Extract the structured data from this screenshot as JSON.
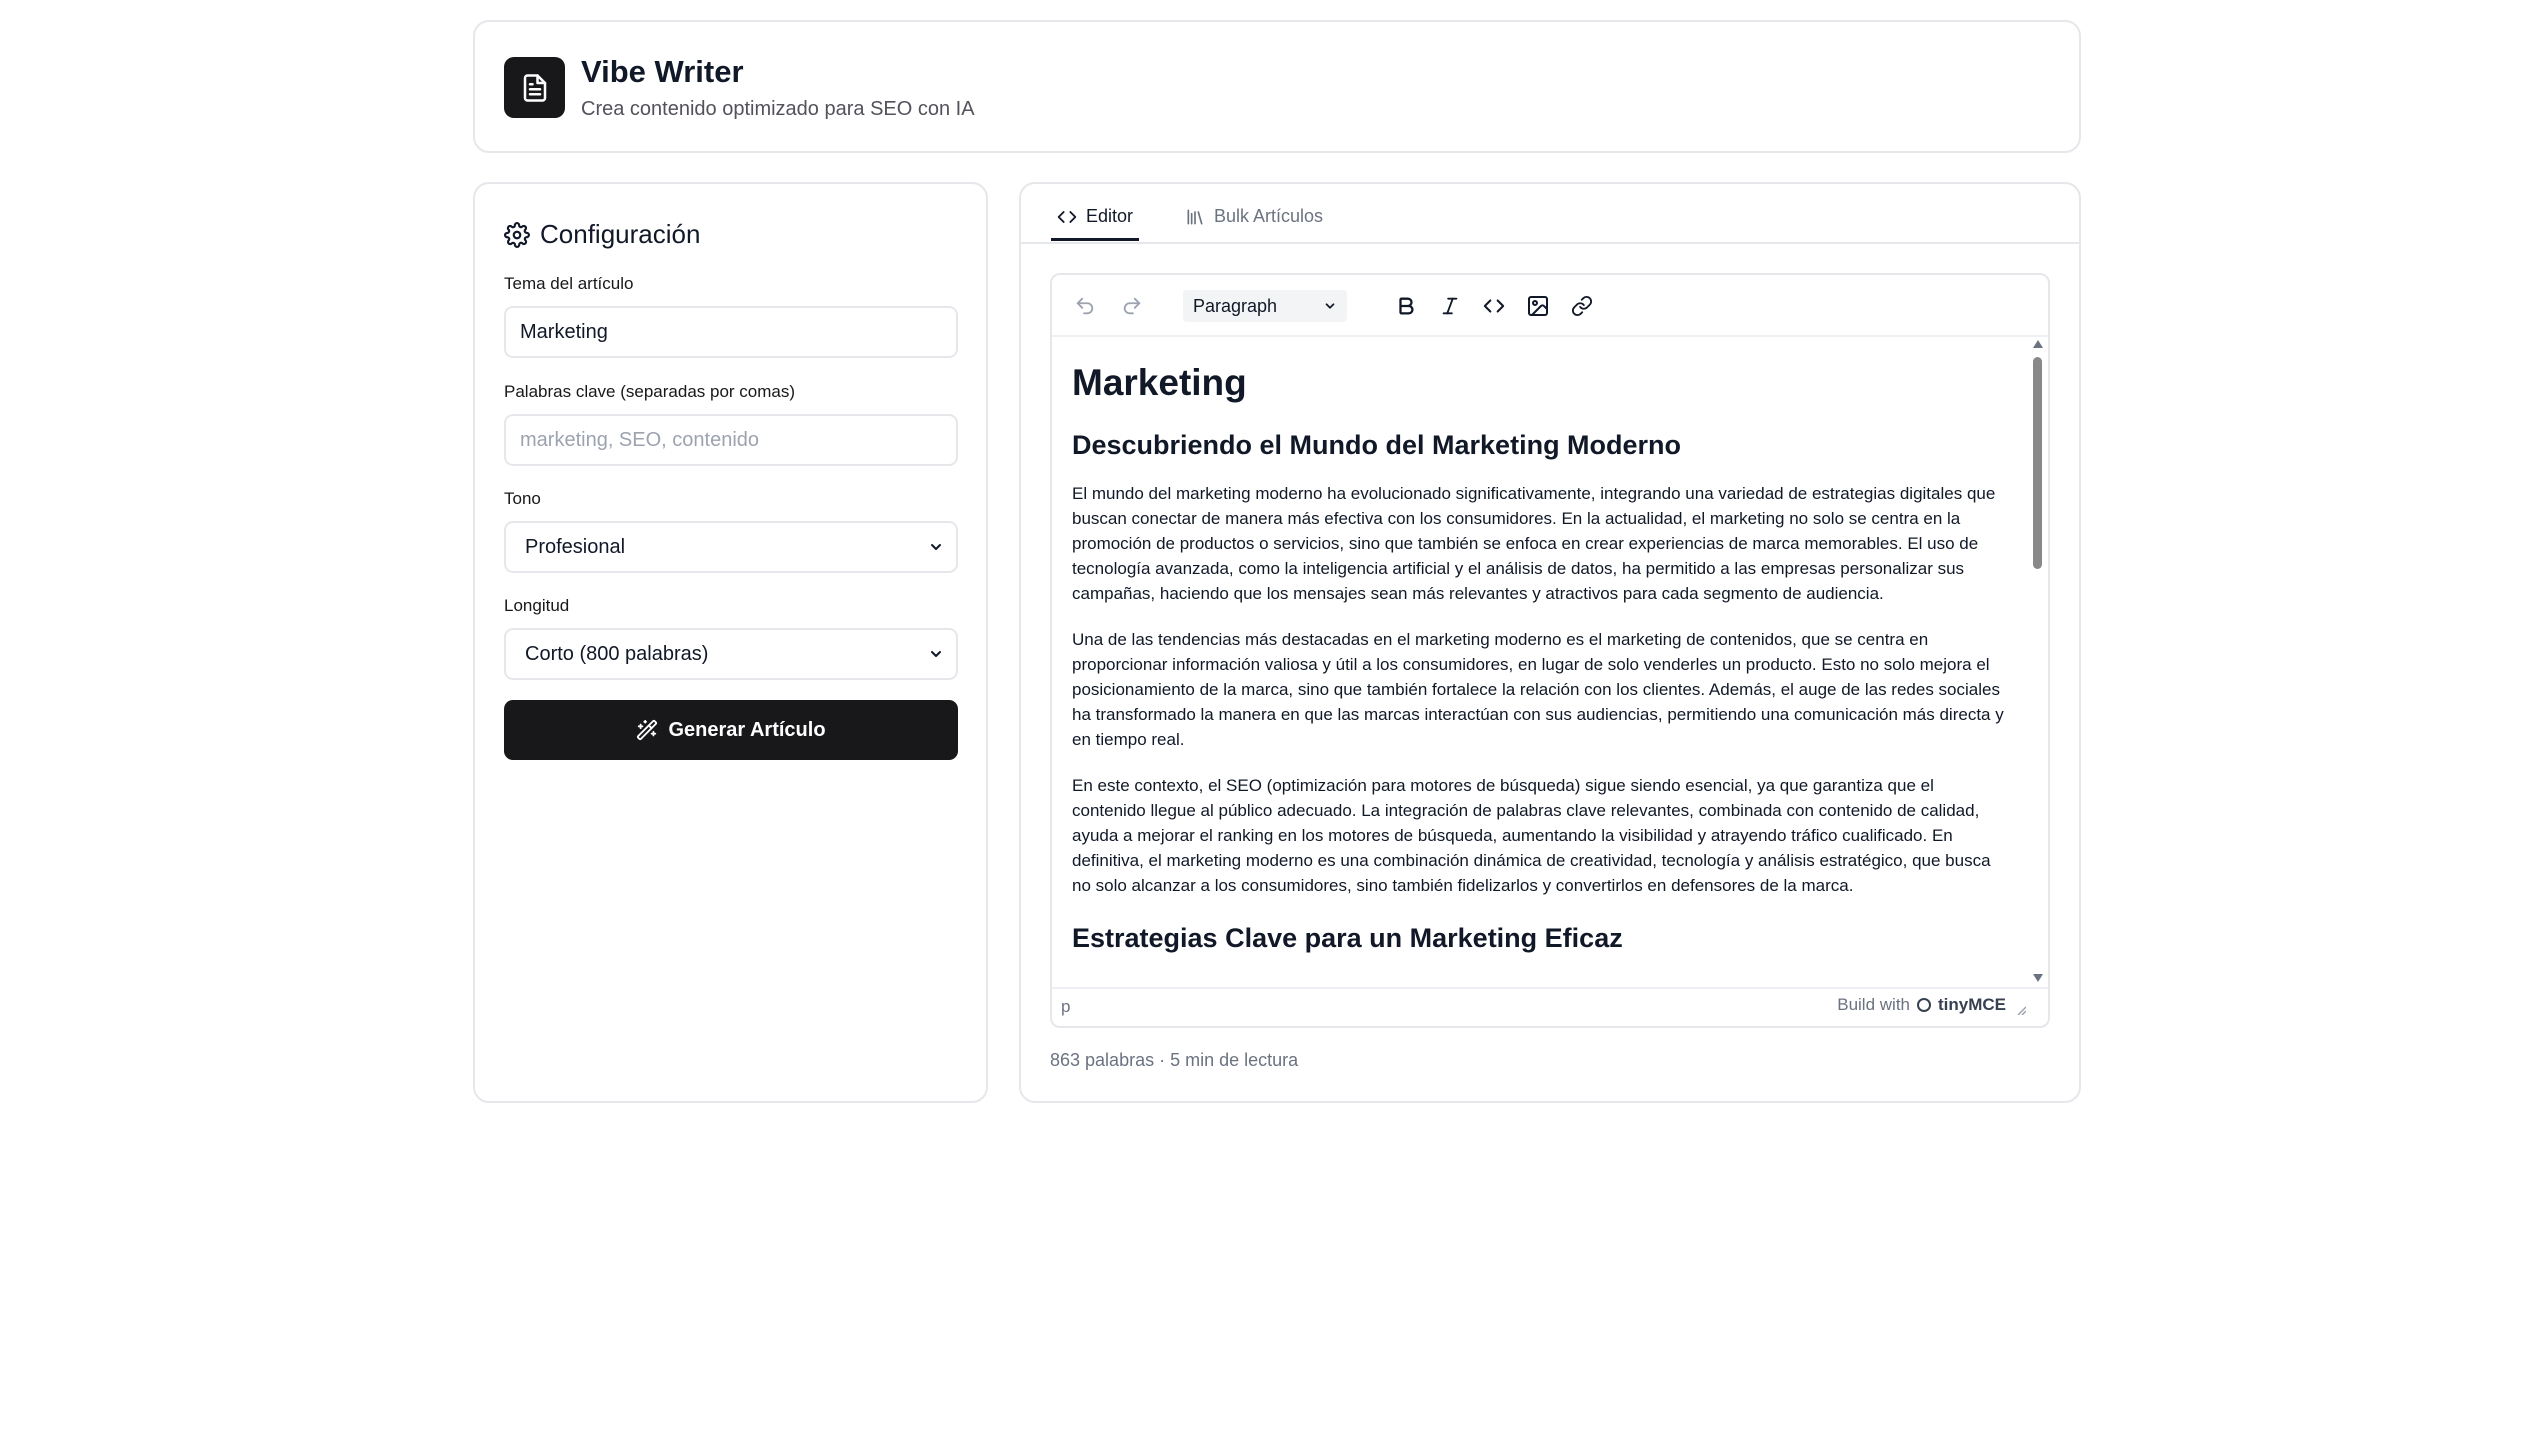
{
  "header": {
    "title": "Vibe Writer",
    "subtitle": "Crea contenido optimizado para SEO con IA",
    "logo_icon": "document-icon"
  },
  "config": {
    "title": "Configuración",
    "topic_label": "Tema del artículo",
    "topic_value": "Marketing",
    "keywords_label": "Palabras clave (separadas por comas)",
    "keywords_placeholder": "marketing, SEO, contenido",
    "tone_label": "Tono",
    "tone_value": "Profesional",
    "length_label": "Longitud",
    "length_value": "Corto (800 palabras)",
    "generate_label": "Generar Artículo"
  },
  "tabs": [
    {
      "label": "Editor",
      "active": true,
      "icon": "code-icon"
    },
    {
      "label": "Bulk Artículos",
      "active": false,
      "icon": "library-icon"
    }
  ],
  "editor": {
    "block_format": "Paragraph",
    "status_path": "p",
    "branding_prefix": "Build with",
    "branding_name": "tinyMCE",
    "content": {
      "h1": "Marketing",
      "h2_1": "Descubriendo el Mundo del Marketing Moderno",
      "p1": "El mundo del marketing moderno ha evolucionado significativamente, integrando una variedad de estrategias digitales que buscan conectar de manera más efectiva con los consumidores. En la actualidad, el marketing no solo se centra en la promoción de productos o servicios, sino que también se enfoca en crear experiencias de marca memorables. El uso de tecnología avanzada, como la inteligencia artificial y el análisis de datos, ha permitido a las empresas personalizar sus campañas, haciendo que los mensajes sean más relevantes y atractivos para cada segmento de audiencia.",
      "p2": "Una de las tendencias más destacadas en el marketing moderno es el marketing de contenidos, que se centra en proporcionar información valiosa y útil a los consumidores, en lugar de solo venderles un producto. Esto no solo mejora el posicionamiento de la marca, sino que también fortalece la relación con los clientes. Además, el auge de las redes sociales ha transformado la manera en que las marcas interactúan con sus audiencias, permitiendo una comunicación más directa y en tiempo real.",
      "p3": "En este contexto, el SEO (optimización para motores de búsqueda) sigue siendo esencial, ya que garantiza que el contenido llegue al público adecuado. La integración de palabras clave relevantes, combinada con contenido de calidad, ayuda a mejorar el ranking en los motores de búsqueda, aumentando la visibilidad y atrayendo tráfico cualificado. En definitiva, el marketing moderno es una combinación dinámica de creatividad, tecnología y análisis estratégico, que busca no solo alcanzar a los consumidores, sino también fidelizarlos y convertirlos en defensores de la marca.",
      "h2_2": "Estrategias Clave para un Marketing Eficaz"
    }
  },
  "stats": "863 palabras · 5 min de lectura",
  "colors": {
    "primary": "#18181b",
    "border": "#e5e7eb",
    "muted_text": "#6b7280"
  }
}
